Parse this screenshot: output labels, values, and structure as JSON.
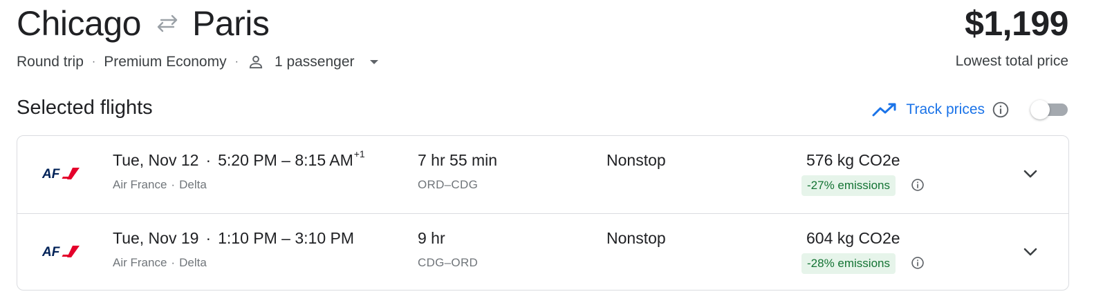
{
  "header": {
    "origin": "Chicago",
    "destination": "Paris",
    "price": "$1,199",
    "price_caption": "Lowest total price"
  },
  "trip_options": {
    "trip_type": "Round trip",
    "cabin_class": "Premium Economy",
    "passengers": "1 passenger",
    "separator": "·"
  },
  "selected_section": {
    "title": "Selected flights",
    "track_prices_label": "Track prices",
    "track_prices_enabled": false
  },
  "flights": [
    {
      "date": "Tue, Nov 12",
      "departure": "5:20 PM",
      "arrival": "8:15 AM",
      "day_offset": "+1",
      "airline": "Air France",
      "partner": "Delta",
      "duration": "7 hr 55 min",
      "route": "ORD–CDG",
      "stops": "Nonstop",
      "co2": "576 kg CO2e",
      "emissions_badge": "-27% emissions"
    },
    {
      "date": "Tue, Nov 19",
      "departure": "1:10 PM",
      "arrival": "3:10 PM",
      "day_offset": "",
      "airline": "Air France",
      "partner": "Delta",
      "duration": "9 hr",
      "route": "CDG–ORD",
      "stops": "Nonstop",
      "co2": "604 kg CO2e",
      "emissions_badge": "-28% emissions"
    }
  ],
  "logo": {
    "text": "AF",
    "colors": {
      "navy": "#002157",
      "red": "#e4002b"
    }
  },
  "colors": {
    "accent": "#1a73e8",
    "emissions_bg": "#e6f4ea",
    "emissions_text": "#137333",
    "border": "#dadce0"
  },
  "icons": {
    "swap": "swap-arrows-icon",
    "person": "person-icon",
    "dropdown": "caret-down-icon",
    "trend": "trending-up-icon",
    "info": "info-icon",
    "expand": "chevron-down-icon"
  }
}
